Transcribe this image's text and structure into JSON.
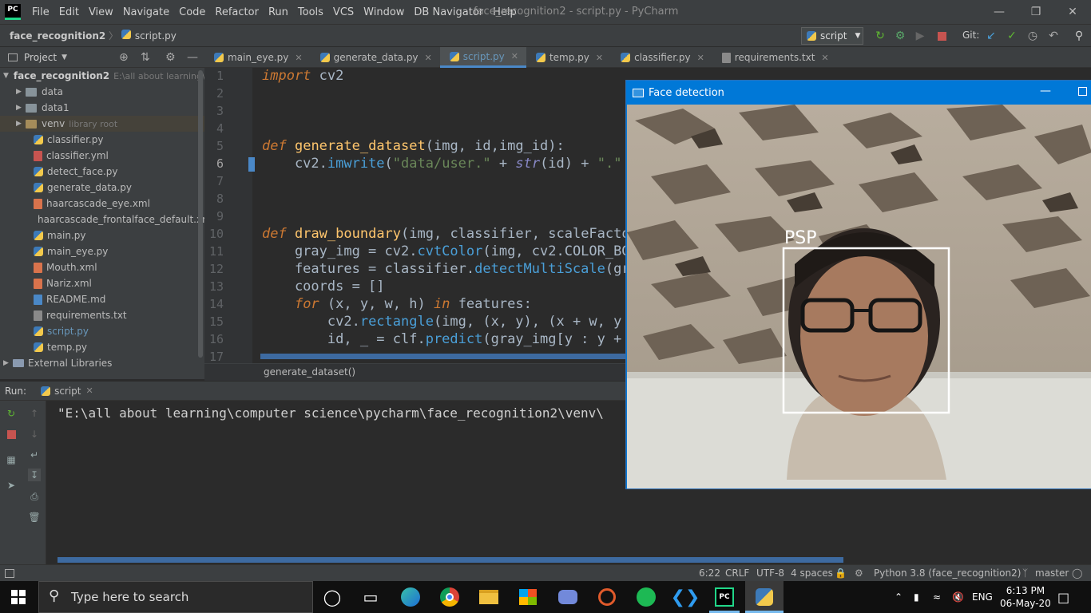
{
  "window": {
    "title": "face_recognition2 - script.py - PyCharm",
    "logo": "PC",
    "menu": [
      "File",
      "Edit",
      "View",
      "Navigate",
      "Code",
      "Refactor",
      "Run",
      "Tools",
      "VCS",
      "Window",
      "DB Navigator",
      "Help"
    ]
  },
  "navbar": {
    "project": "face_recognition2",
    "file": "script.py",
    "run_config": "script",
    "git_label": "Git:"
  },
  "project_panel": {
    "title": "Project",
    "root": {
      "name": "face_recognition2",
      "path": "E:\\all about learning\\"
    },
    "items": [
      {
        "name": "data",
        "type": "folder"
      },
      {
        "name": "data1",
        "type": "folder"
      },
      {
        "name": "venv",
        "type": "folder",
        "hint": "library root"
      },
      {
        "name": "classifier.py",
        "type": "py"
      },
      {
        "name": "classifier.yml",
        "type": "yml"
      },
      {
        "name": "detect_face.py",
        "type": "py"
      },
      {
        "name": "generate_data.py",
        "type": "py"
      },
      {
        "name": "haarcascade_eye.xml",
        "type": "xml"
      },
      {
        "name": "haarcascade_frontalface_default.xml",
        "type": "xml"
      },
      {
        "name": "main.py",
        "type": "py"
      },
      {
        "name": "main_eye.py",
        "type": "py"
      },
      {
        "name": "Mouth.xml",
        "type": "xml"
      },
      {
        "name": "Nariz.xml",
        "type": "xml"
      },
      {
        "name": "README.md",
        "type": "md"
      },
      {
        "name": "requirements.txt",
        "type": "txt"
      },
      {
        "name": "script.py",
        "type": "py",
        "selected": true
      },
      {
        "name": "temp.py",
        "type": "py"
      }
    ],
    "external": "External Libraries"
  },
  "tabs": [
    {
      "label": "main_eye.py",
      "active": false
    },
    {
      "label": "generate_data.py",
      "active": false
    },
    {
      "label": "script.py",
      "active": true
    },
    {
      "label": "temp.py",
      "active": false
    },
    {
      "label": "classifier.py",
      "active": false
    },
    {
      "label": "requirements.txt",
      "active": false
    }
  ],
  "editor": {
    "lines": [
      "1",
      "2",
      "3",
      "4",
      "5",
      "6",
      "7",
      "8",
      "9",
      "10",
      "11",
      "12",
      "13",
      "14",
      "15",
      "16",
      "17"
    ],
    "breadcrumb": "generate_dataset()"
  },
  "run_panel": {
    "label": "Run:",
    "tab": "script",
    "console_line": "\"E:\\all about learning\\computer science\\pycharm\\face_recognition2\\venv\\"
  },
  "statusbar": {
    "position": "6:22",
    "line_sep": "CRLF",
    "encoding": "UTF-8",
    "indent": "4 spaces",
    "interpreter": "Python 3.8 (face_recognition2)",
    "branch": "master"
  },
  "face_window": {
    "title": "Face detection",
    "label": "PSP"
  },
  "taskbar": {
    "search_placeholder": "Type here to search",
    "language": "ENG",
    "time": "6:13 PM",
    "date": "06-May-20"
  }
}
